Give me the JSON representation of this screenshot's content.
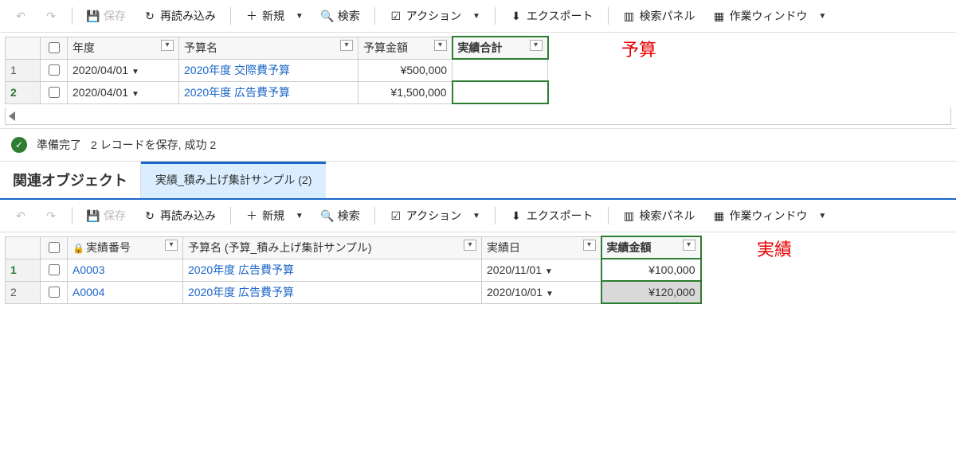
{
  "toolbar": {
    "save": "保存",
    "reload": "再読み込み",
    "new": "新規",
    "search": "検索",
    "action": "アクション",
    "export": "エクスポート",
    "searchPanel": "検索パネル",
    "workWindow": "作業ウィンドウ"
  },
  "upper": {
    "annotation": "予算",
    "headers": {
      "year": "年度",
      "budgetName": "予算名",
      "budgetAmount": "予算金額",
      "actualTotal": "実績合計"
    },
    "rows": [
      {
        "num": "1",
        "year": "2020/04/01",
        "name": "2020年度 交際費予算",
        "amount": "¥500,000",
        "total": ""
      },
      {
        "num": "2",
        "year": "2020/04/01",
        "name": "2020年度 広告費予算",
        "amount": "¥1,500,000",
        "total": ""
      }
    ]
  },
  "status": {
    "ready": "準備完了",
    "msg": "2 レコードを保存, 成功 2"
  },
  "tabs": {
    "main": "関連オブジェクト",
    "sub": "実績_積み上げ集計サンプル (2)"
  },
  "lower": {
    "annotation": "実績",
    "headers": {
      "actualNo": "実績番号",
      "budgetName": "予算名 (予算_積み上げ集計サンプル)",
      "actualDate": "実績日",
      "actualAmount": "実績金額"
    },
    "rows": [
      {
        "num": "1",
        "no": "A0003",
        "name": "2020年度 広告費予算",
        "date": "2020/11/01",
        "amount": "¥100,000"
      },
      {
        "num": "2",
        "no": "A0004",
        "name": "2020年度 広告費予算",
        "date": "2020/10/01",
        "amount": "¥120,000"
      }
    ]
  }
}
